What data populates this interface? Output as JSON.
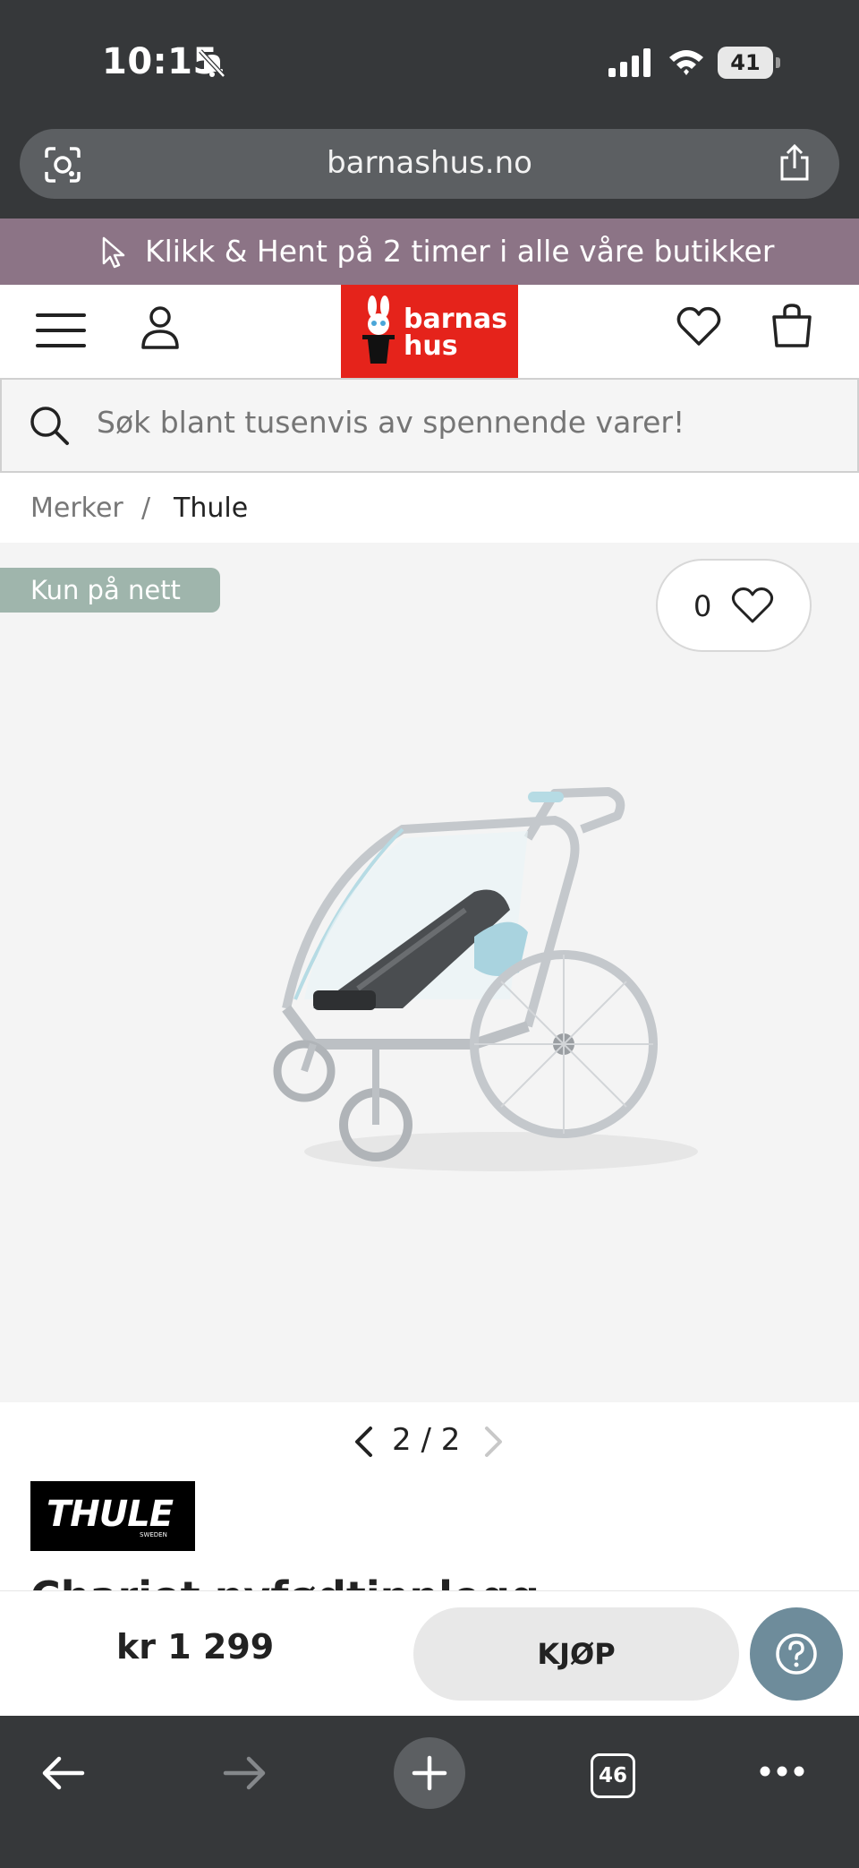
{
  "status_bar": {
    "time": "10:15",
    "battery": "41"
  },
  "browser": {
    "url": "barnashus.no",
    "tab_count": "46"
  },
  "promo": {
    "text": "Klikk & Hent på 2 timer i alle våre butikker"
  },
  "header": {
    "logo_line1": "barnas",
    "logo_line2": "hus"
  },
  "search": {
    "placeholder": "Søk blant tusenvis av spennende varer!"
  },
  "breadcrumb": {
    "items": [
      "Merker",
      "Thule"
    ],
    "separator": "/"
  },
  "gallery": {
    "badge": "Kun på nett",
    "favorite_count": "0",
    "pager": "2 / 2"
  },
  "brand": {
    "name": "THULE",
    "sub": "SWEDEN"
  },
  "product": {
    "title": "Chariot nyfødtinnlegg",
    "price": "kr 1 299",
    "buy_label": "KJØP"
  },
  "colors": {
    "chrome": "#36383a",
    "promo": "#8c7486",
    "logo": "#e5231b",
    "badge": "#9fb5ac",
    "help": "#6e8c9b"
  }
}
